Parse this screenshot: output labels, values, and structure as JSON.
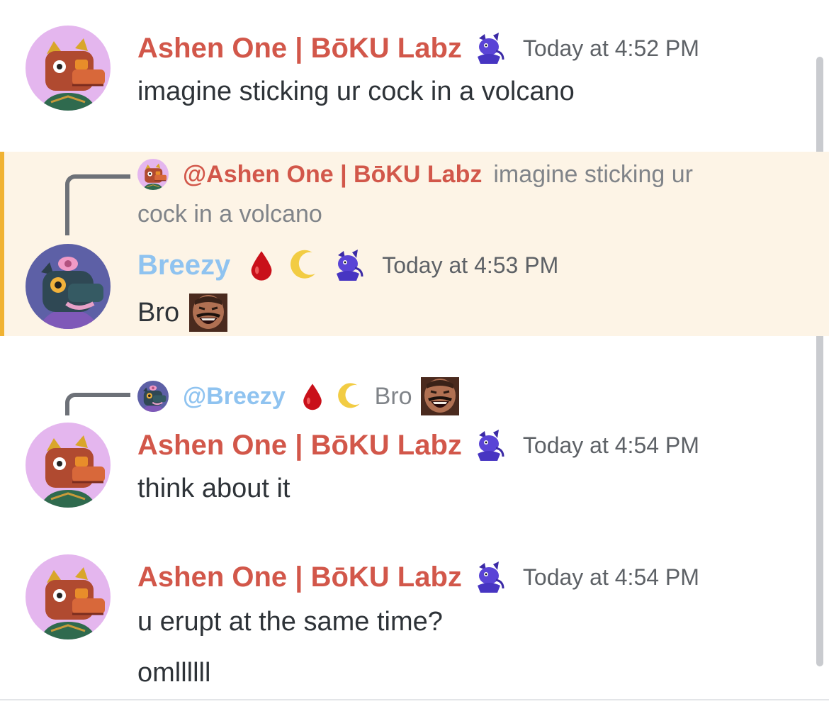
{
  "colors": {
    "name_red": "#d2574a",
    "name_blue": "#8fc3f0",
    "highlight_bg": "#fdf4e6",
    "highlight_bar": "#f0b232",
    "timestamp": "#5d6166"
  },
  "messages": [
    {
      "author": "Ashen One | BōKU Labz",
      "badge_icon": "purple-dragon-icon",
      "timestamp": "Today at 4:52 PM",
      "lines": [
        "imagine sticking ur cock in a volcano"
      ]
    },
    {
      "reply": {
        "author": "@Ashen One | BōKU Labz",
        "text_a": "imagine sticking ur",
        "text_b": "cock in a volcano"
      },
      "author": "Breezy",
      "badges": [
        "blood-drop-icon",
        "crescent-moon-icon",
        "purple-dragon-icon"
      ],
      "timestamp": "Today at 4:53 PM",
      "lines": [
        "Bro"
      ],
      "inline_emoji": "laughing-man-emoji"
    },
    {
      "reply": {
        "author": "@Breezy",
        "text": "Bro",
        "badges": [
          "blood-drop-icon",
          "crescent-moon-icon"
        ],
        "inline_emoji": "laughing-man-emoji"
      },
      "author": "Ashen One | BōKU Labz",
      "badge_icon": "purple-dragon-icon",
      "timestamp": "Today at 4:54 PM",
      "lines": [
        "think about it"
      ]
    },
    {
      "author": "Ashen One | BōKU Labz",
      "badge_icon": "purple-dragon-icon",
      "timestamp": "Today at 4:54 PM",
      "lines": [
        "u erupt at the same time?",
        "omllllll"
      ]
    }
  ]
}
